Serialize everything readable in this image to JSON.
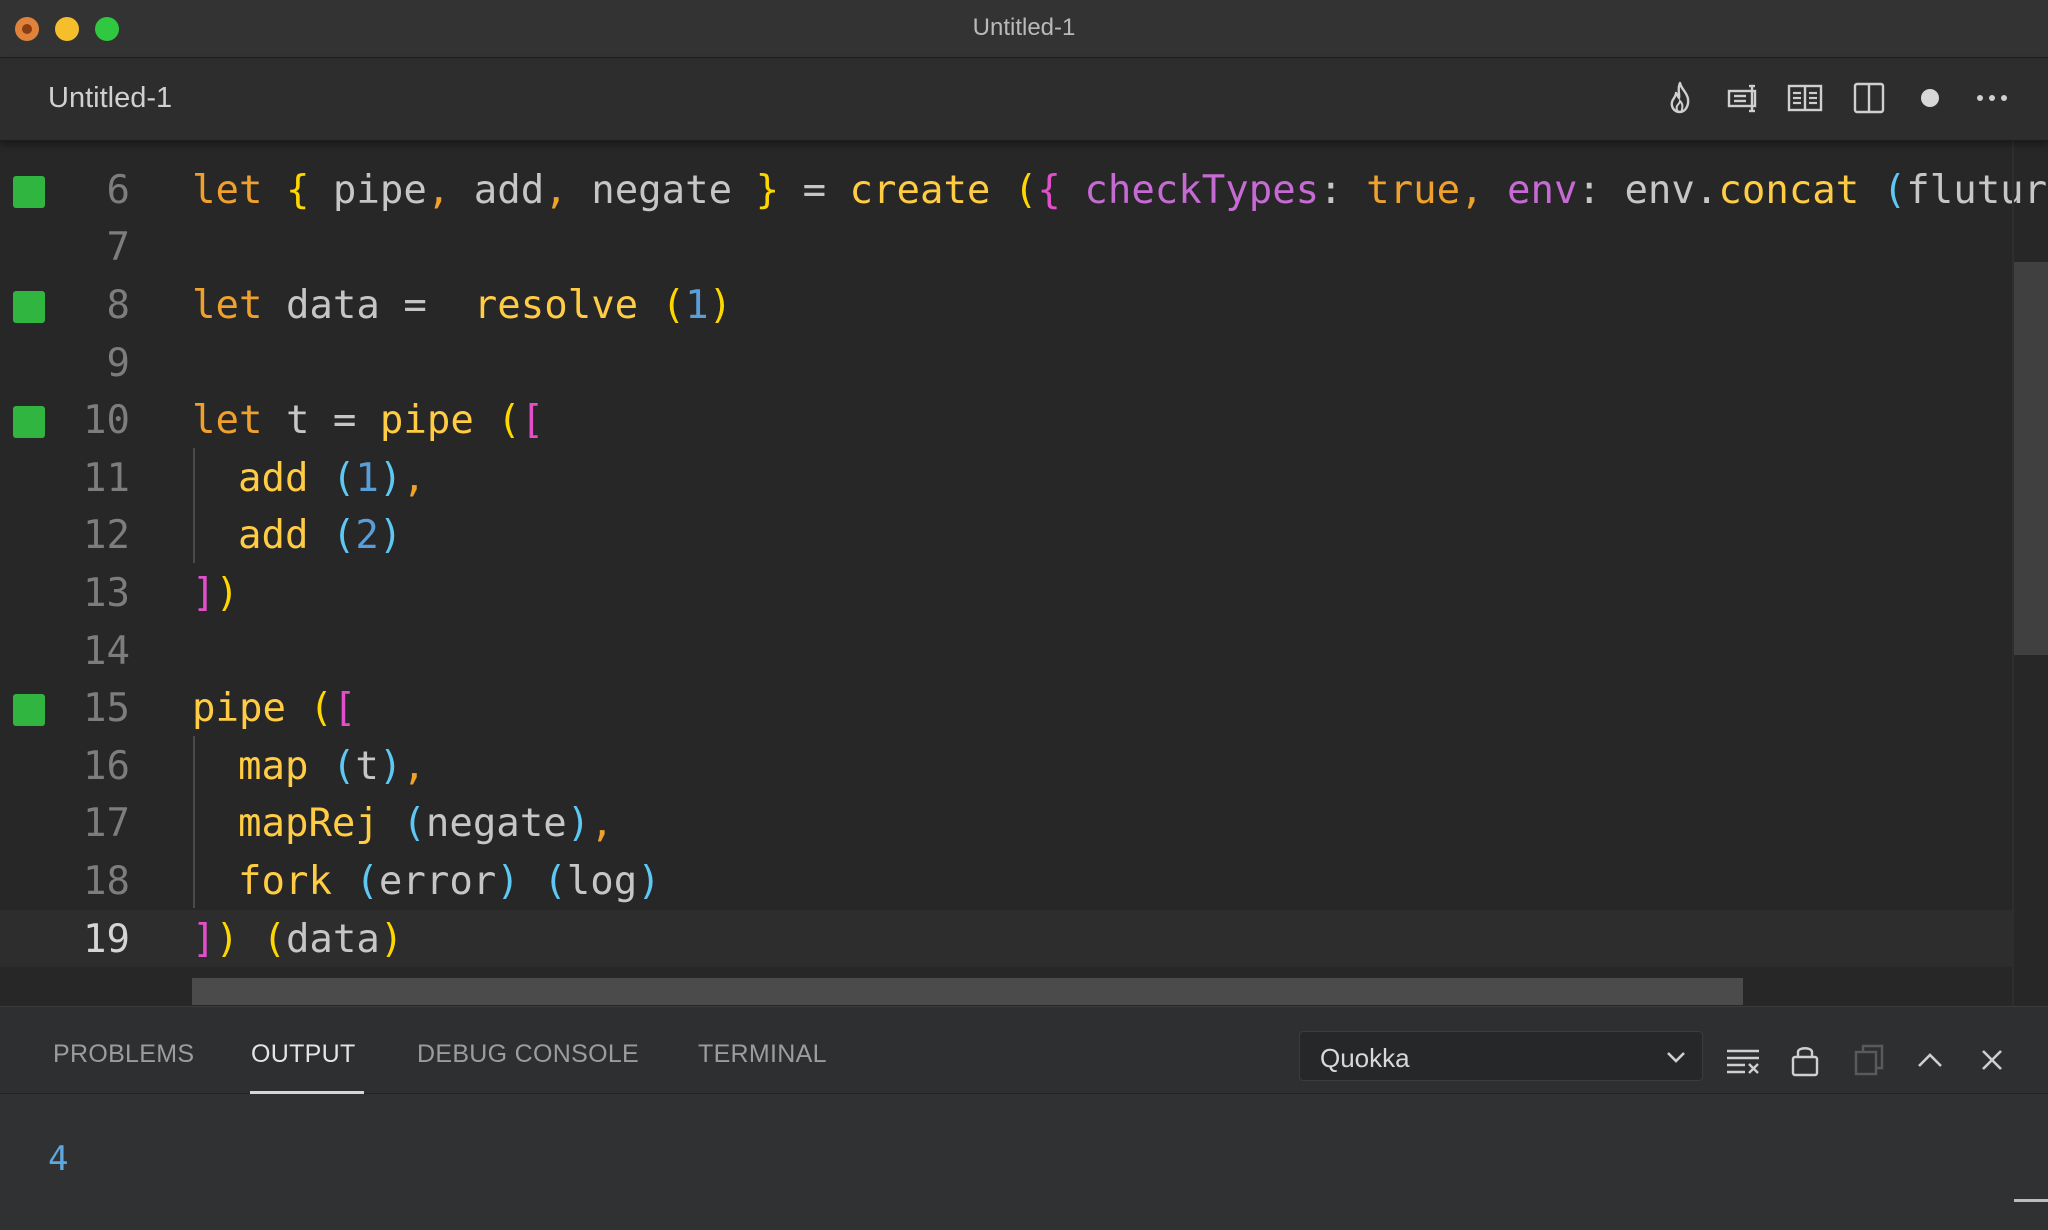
{
  "window": {
    "title": "Untitled-1"
  },
  "tab": {
    "label": "Untitled-1"
  },
  "toolbar": {
    "icons": [
      "flame-icon",
      "preview-icon",
      "open-book-icon",
      "split-editor-icon",
      "unsaved-dot-icon",
      "more-actions-icon"
    ]
  },
  "editor": {
    "lines": [
      {
        "num": "6",
        "marker": true,
        "current": false
      },
      {
        "num": "7",
        "marker": false,
        "current": false
      },
      {
        "num": "8",
        "marker": true,
        "current": false
      },
      {
        "num": "9",
        "marker": false,
        "current": false
      },
      {
        "num": "10",
        "marker": true,
        "current": false
      },
      {
        "num": "11",
        "marker": false,
        "current": false
      },
      {
        "num": "12",
        "marker": false,
        "current": false
      },
      {
        "num": "13",
        "marker": false,
        "current": false
      },
      {
        "num": "14",
        "marker": false,
        "current": false
      },
      {
        "num": "15",
        "marker": true,
        "current": false
      },
      {
        "num": "16",
        "marker": false,
        "current": false
      },
      {
        "num": "17",
        "marker": false,
        "current": false
      },
      {
        "num": "18",
        "marker": false,
        "current": false
      },
      {
        "num": "19",
        "marker": false,
        "current": true
      }
    ],
    "code": {
      "l6": [
        "let",
        "{",
        "pipe",
        ",",
        "add",
        ",",
        "negate",
        "}",
        "=",
        "create",
        "(",
        "{",
        "checkTypes",
        ":",
        "true",
        ",",
        "env",
        ":",
        "env",
        ".",
        "concat",
        "(",
        "flutur"
      ],
      "l8": [
        "let",
        "data",
        "=",
        "resolve",
        "(",
        "1",
        ")"
      ],
      "l10": [
        "let",
        "t",
        "=",
        "pipe",
        "(",
        "["
      ],
      "l11": [
        "add",
        "(",
        "1",
        ")",
        ","
      ],
      "l12": [
        "add",
        "(",
        "2",
        ")"
      ],
      "l13": [
        "]",
        ")"
      ],
      "l15": [
        "pipe",
        "(",
        "["
      ],
      "l16": [
        "map",
        "(",
        "t",
        ")",
        ","
      ],
      "l17": [
        "mapRej",
        "(",
        "negate",
        ")",
        ","
      ],
      "l18": [
        "fork",
        "(",
        "error",
        ")",
        "(",
        "log",
        ")"
      ],
      "l19": [
        "]",
        ")",
        "(",
        "data",
        ")"
      ]
    }
  },
  "panel": {
    "tabs": [
      "PROBLEMS",
      "OUTPUT",
      "DEBUG CONSOLE",
      "TERMINAL"
    ],
    "active_tab": "OUTPUT",
    "channel": "Quokka",
    "output": "4",
    "icons": [
      "clear-output-icon",
      "lock-scroll-icon",
      "open-editor-icon",
      "maximize-panel-icon",
      "close-panel-icon"
    ]
  },
  "colors": {
    "keyword": "#f0a02d",
    "function": "#ffcc44",
    "brace": "#ffd700",
    "bracket": "#e34fcb",
    "paren": "#5ec8f2",
    "number": "#5a9ed9",
    "property": "#c56bd3",
    "gutter_marker": "#2fb540"
  }
}
